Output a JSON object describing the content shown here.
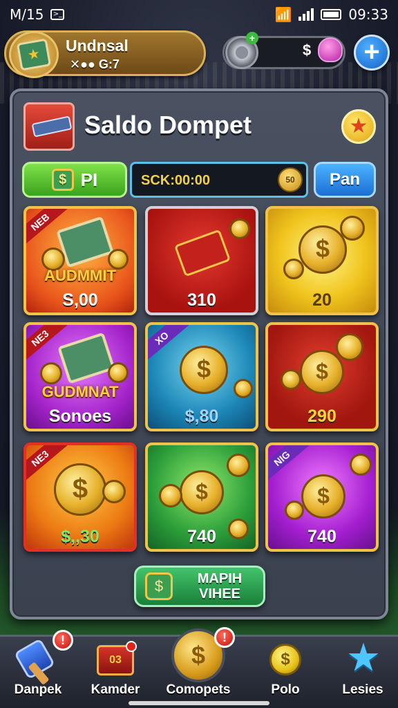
{
  "status_bar": {
    "time": "M/15",
    "right_text": "09:33"
  },
  "player": {
    "name": "Undnsal",
    "level_text": "✕●● G:7"
  },
  "currency": {
    "symbol": "$"
  },
  "header": {
    "add_label": "+"
  },
  "panel": {
    "title": "Saldo Dompet",
    "pi_label": "PI",
    "timer_text": "SCK:00:00",
    "timer_coin_label": "50",
    "pan_label": "Pan"
  },
  "tiles": [
    {
      "badge": "NEB",
      "name": "AUDMMIT",
      "value": "S,00"
    },
    {
      "badge": "",
      "name": "",
      "value": "310"
    },
    {
      "badge": "",
      "name": "",
      "value": "20"
    },
    {
      "badge": "NE3",
      "name": "GUDMNAT",
      "value": "Sonoes"
    },
    {
      "badge": "XO",
      "name": "",
      "value": "$,80"
    },
    {
      "badge": "",
      "name": "",
      "value": "290"
    },
    {
      "badge": "NE3",
      "name": "",
      "value": "$,,30"
    },
    {
      "badge": "",
      "name": "",
      "value": "740"
    },
    {
      "badge": "NIG",
      "name": "",
      "value": "740"
    }
  ],
  "map_button": {
    "line1": "MAPIH",
    "line2": "VIHEE"
  },
  "nav": [
    {
      "label": "Danpek",
      "icon": "hammer-icon",
      "alert": "!"
    },
    {
      "label": "Kamder",
      "icon": "box-icon",
      "alert": "",
      "icon_text": "03"
    },
    {
      "label": "Comopets",
      "icon": "coin-icon",
      "alert": "!"
    },
    {
      "label": "Polo",
      "icon": "coin-icon",
      "alert": ""
    },
    {
      "label": "Lesies",
      "icon": "star-icon",
      "alert": ""
    }
  ]
}
